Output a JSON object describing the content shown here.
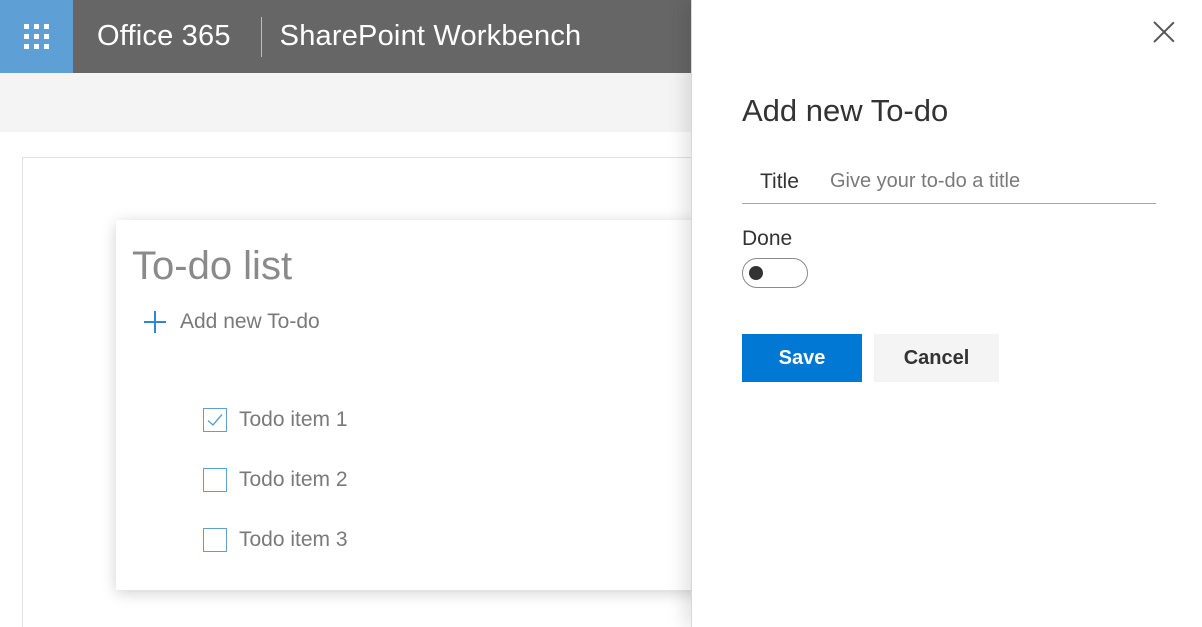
{
  "suite_bar": {
    "brand": "Office 365",
    "app_title": "SharePoint Workbench"
  },
  "webpart": {
    "title": "To-do list",
    "add_label": "Add new To-do",
    "items": [
      {
        "label": "Todo item 1",
        "done": true
      },
      {
        "label": "Todo item 2",
        "done": false
      },
      {
        "label": "Todo item 3",
        "done": false
      }
    ]
  },
  "panel": {
    "heading": "Add new To-do",
    "title_label": "Title",
    "title_value": "",
    "title_placeholder": "Give your to-do a title",
    "done_label": "Done",
    "done_value": false,
    "save_label": "Save",
    "cancel_label": "Cancel"
  },
  "colors": {
    "suite_bar": "#666666",
    "waffle": "#5e9fd6",
    "accent": "#0078d4",
    "checkbox_border": "#5e9fd6"
  }
}
